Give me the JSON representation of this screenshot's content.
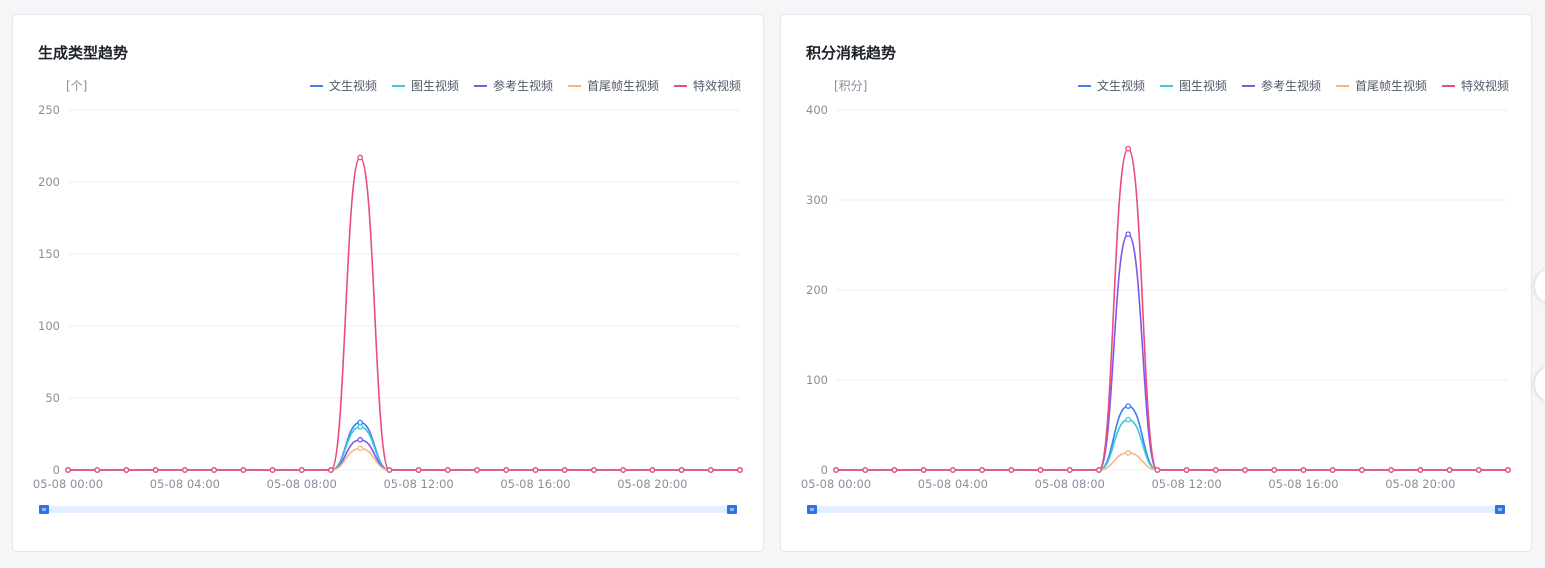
{
  "cards": [
    {
      "title": "生成类型趋势"
    },
    {
      "title": "积分消耗趋势"
    }
  ],
  "legend_labels": [
    "文生视频",
    "图生视频",
    "参考生视频",
    "首尾帧生视频",
    "特效视频"
  ],
  "colors": {
    "文生视频": "#3d7ff5",
    "图生视频": "#3ec9d6",
    "参考生视频": "#7e56f0",
    "首尾帧生视频": "#f7b77a",
    "特效视频": "#ea4c7e",
    "grid": "#ececf0",
    "axis_text": "#86909c",
    "zoom_handle": "#2b72e4",
    "zoom_track": "#e3efff"
  },
  "chart_data": [
    {
      "type": "line",
      "title": "生成类型趋势",
      "ylabel": "[个]",
      "ylim": [
        0,
        250
      ],
      "yticks": [
        0,
        50,
        100,
        150,
        200,
        250
      ],
      "xticks": [
        "05-08 00:00",
        "05-08 04:00",
        "05-08 08:00",
        "05-08 12:00",
        "05-08 16:00",
        "05-08 20:00"
      ],
      "x": [
        "05-08 00:00",
        "05-08 01:00",
        "05-08 02:00",
        "05-08 03:00",
        "05-08 04:00",
        "05-08 05:00",
        "05-08 06:00",
        "05-08 07:00",
        "05-08 08:00",
        "05-08 09:00",
        "05-08 10:00",
        "05-08 11:00",
        "05-08 12:00",
        "05-08 13:00",
        "05-08 14:00",
        "05-08 15:00",
        "05-08 16:00",
        "05-08 17:00",
        "05-08 18:00",
        "05-08 19:00",
        "05-08 20:00",
        "05-08 21:00",
        "05-08 22:00",
        "05-08 23:00"
      ],
      "legend_position": "top-right",
      "grid": true,
      "series": [
        {
          "name": "文生视频",
          "values": [
            0,
            0,
            0,
            0,
            0,
            0,
            0,
            0,
            0,
            0,
            33,
            0,
            0,
            0,
            0,
            0,
            0,
            0,
            0,
            0,
            0,
            0,
            0,
            0
          ]
        },
        {
          "name": "图生视频",
          "values": [
            0,
            0,
            0,
            0,
            0,
            0,
            0,
            0,
            0,
            0,
            30,
            0,
            0,
            0,
            0,
            0,
            0,
            0,
            0,
            0,
            0,
            0,
            0,
            0
          ]
        },
        {
          "name": "参考生视频",
          "values": [
            0,
            0,
            0,
            0,
            0,
            0,
            0,
            0,
            0,
            0,
            21,
            0,
            0,
            0,
            0,
            0,
            0,
            0,
            0,
            0,
            0,
            0,
            0,
            0
          ]
        },
        {
          "name": "首尾帧生视频",
          "values": [
            0,
            0,
            0,
            0,
            0,
            0,
            0,
            0,
            0,
            0,
            15,
            0,
            0,
            0,
            0,
            0,
            0,
            0,
            0,
            0,
            0,
            0,
            0,
            0
          ]
        },
        {
          "name": "特效视频",
          "values": [
            0,
            0,
            0,
            0,
            0,
            0,
            0,
            0,
            0,
            0,
            217,
            0,
            0,
            0,
            0,
            0,
            0,
            0,
            0,
            0,
            0,
            0,
            0,
            0
          ]
        }
      ]
    },
    {
      "type": "line",
      "title": "积分消耗趋势",
      "ylabel": "[积分]",
      "ylim": [
        0,
        400
      ],
      "yticks": [
        0,
        100,
        200,
        300,
        400
      ],
      "xticks": [
        "05-08 00:00",
        "05-08 04:00",
        "05-08 08:00",
        "05-08 12:00",
        "05-08 16:00",
        "05-08 20:00"
      ],
      "x": [
        "05-08 00:00",
        "05-08 01:00",
        "05-08 02:00",
        "05-08 03:00",
        "05-08 04:00",
        "05-08 05:00",
        "05-08 06:00",
        "05-08 07:00",
        "05-08 08:00",
        "05-08 09:00",
        "05-08 10:00",
        "05-08 11:00",
        "05-08 12:00",
        "05-08 13:00",
        "05-08 14:00",
        "05-08 15:00",
        "05-08 16:00",
        "05-08 17:00",
        "05-08 18:00",
        "05-08 19:00",
        "05-08 20:00",
        "05-08 21:00",
        "05-08 22:00",
        "05-08 23:00"
      ],
      "legend_position": "top-right",
      "grid": true,
      "series": [
        {
          "name": "文生视频",
          "values": [
            0,
            0,
            0,
            0,
            0,
            0,
            0,
            0,
            0,
            0,
            71,
            0,
            0,
            0,
            0,
            0,
            0,
            0,
            0,
            0,
            0,
            0,
            0,
            0
          ]
        },
        {
          "name": "图生视频",
          "values": [
            0,
            0,
            0,
            0,
            0,
            0,
            0,
            0,
            0,
            0,
            56,
            0,
            0,
            0,
            0,
            0,
            0,
            0,
            0,
            0,
            0,
            0,
            0,
            0
          ]
        },
        {
          "name": "参考生视频",
          "values": [
            0,
            0,
            0,
            0,
            0,
            0,
            0,
            0,
            0,
            0,
            262,
            0,
            0,
            0,
            0,
            0,
            0,
            0,
            0,
            0,
            0,
            0,
            0,
            0
          ]
        },
        {
          "name": "首尾帧生视频",
          "values": [
            0,
            0,
            0,
            0,
            0,
            0,
            0,
            0,
            0,
            0,
            19,
            0,
            0,
            0,
            0,
            0,
            0,
            0,
            0,
            0,
            0,
            0,
            0,
            0
          ]
        },
        {
          "name": "特效视频",
          "values": [
            0,
            0,
            0,
            0,
            0,
            0,
            0,
            0,
            0,
            0,
            357,
            0,
            0,
            0,
            0,
            0,
            0,
            0,
            0,
            0,
            0,
            0,
            0,
            0
          ]
        }
      ]
    }
  ]
}
